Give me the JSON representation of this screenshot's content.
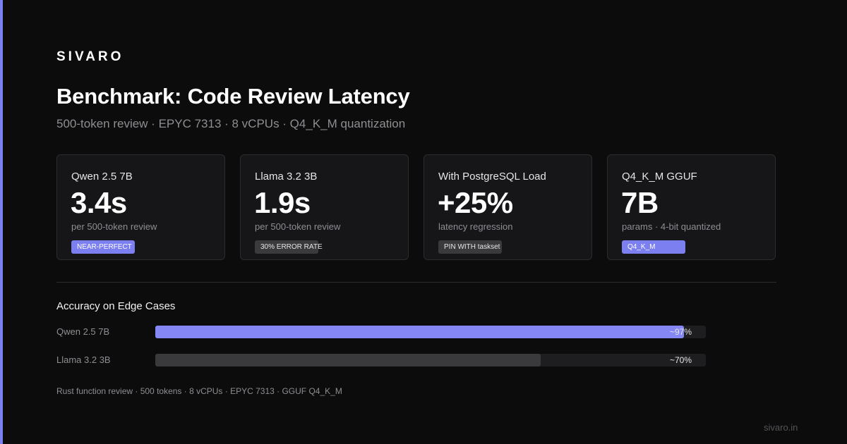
{
  "brand": {
    "logo": "SIVARO",
    "site": "sivaro.in",
    "accent_color": "#7c7ff0"
  },
  "header": {
    "title": "Benchmark: Code Review Latency",
    "subtitle": "500-token review · EPYC 7313 · 8 vCPUs · Q4_K_M quantization"
  },
  "cards": [
    {
      "label": "Qwen 2.5 7B",
      "value": "3.4s",
      "desc": "per 500-token review",
      "tag": "NEAR-PERFECT",
      "tag_style": "accent"
    },
    {
      "label": "Llama 3.2 3B",
      "value": "1.9s",
      "desc": "per 500-token review",
      "tag": "30% ERROR RATE",
      "tag_style": "dark"
    },
    {
      "label": "With PostgreSQL Load",
      "value": "+25%",
      "desc": "latency regression",
      "tag": "PIN WITH taskset",
      "tag_style": "dark"
    },
    {
      "label": "Q4_K_M GGUF",
      "value": "7B",
      "desc": "params · 4-bit quantized",
      "tag": "Q4_K_M",
      "tag_style": "accent"
    }
  ],
  "accuracy": {
    "title": "Accuracy on Edge Cases",
    "bars": [
      {
        "label": "Qwen 2.5 7B",
        "value_text": "~97%",
        "fraction": 0.96,
        "style": "accent"
      },
      {
        "label": "Llama 3.2 3B",
        "value_text": "~70%",
        "fraction": 0.7,
        "style": "dark"
      }
    ]
  },
  "footnote": "Rust function review · 500 tokens · 8 vCPUs · EPYC 7313 · GGUF Q4_K_M"
}
